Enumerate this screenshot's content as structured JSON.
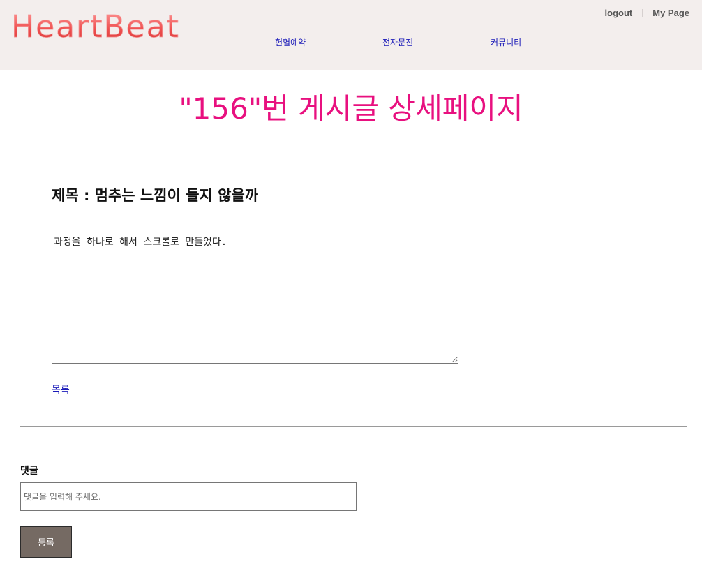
{
  "header": {
    "logo_text": "HeartBeat",
    "top_links": {
      "logout": "logout",
      "my_page": "My Page"
    },
    "nav": [
      {
        "label": "헌혈예약"
      },
      {
        "label": "전자문진"
      },
      {
        "label": "커뮤니티"
      }
    ]
  },
  "main": {
    "page_title": "\"156\"번 게시글 상세페이지",
    "post_title": "제목 : 멈추는 느낌이 들지 않을까",
    "post_content": "과정을 하나로 해서 스크롤로 만들었다.",
    "list_link": "목록"
  },
  "comment": {
    "label": "댓글",
    "placeholder": "댓글을 입력해 주세요.",
    "value": "",
    "submit_label": "등록"
  },
  "colors": {
    "header_bg": "#f3eeed",
    "logo": "#ef5050",
    "title_accent": "#e8107f",
    "nav_link": "#1a1ab8",
    "button_bg": "#756a63"
  }
}
